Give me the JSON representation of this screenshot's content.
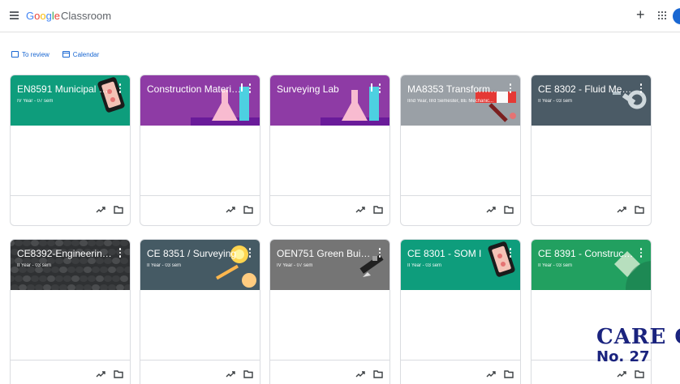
{
  "app": {
    "brand_google": [
      "G",
      "o",
      "o",
      "g",
      "l",
      "e"
    ],
    "brand_product": "Classroom"
  },
  "subnav": {
    "to_review": "To review",
    "calendar": "Calendar"
  },
  "colors": {
    "teal": "#0e9d7c",
    "purple": "#8e3ba5",
    "gray": "#9aa0a6",
    "slate": "#4b5b66",
    "dark": "#2f3133",
    "green": "#22a060",
    "accent": "#1967d2"
  },
  "cards": [
    {
      "title": "EN8591 Municipal soli...",
      "section": "IV Year - 07 sem",
      "color": "#0e9d7c",
      "art": "phone"
    },
    {
      "title": "Construction Materia...",
      "section": "",
      "color": "#8e3ba5",
      "art": "flask"
    },
    {
      "title": "Surveying Lab",
      "section": "",
      "color": "#8e3ba5",
      "art": "flask"
    },
    {
      "title": "MA8353 Transforms ...",
      "section": "IInd Year, IIrd Semester, BE Mechanic...",
      "color": "#9aa0a6",
      "art": "tools"
    },
    {
      "title": "CE 8302 - Fluid Mech...",
      "section": "II Year - 03 sem",
      "color": "#4b5b66",
      "art": "wrench"
    },
    {
      "title": "CE8392-Engineering ...",
      "section": "II Year - 03 sem",
      "color": "#2f3133",
      "art": "gravel"
    },
    {
      "title": "CE 8351 / Surveying",
      "section": "II Year - 03 sem",
      "color": "#455a64",
      "art": "bulb"
    },
    {
      "title": "OEN751 Green Buildi...",
      "section": "IV Year - 07 sem",
      "color": "#757575",
      "art": "pen"
    },
    {
      "title": "CE 8301 - SOM I",
      "section": "II Year - 03 sem",
      "color": "#0e9d7c",
      "art": "phone"
    },
    {
      "title": "CE 8391 - Constructi...",
      "section": "II Year - 03 sem",
      "color": "#22a060",
      "art": "diamond"
    }
  ],
  "watermark": {
    "line1": "CARE C",
    "line2": "No. 27"
  },
  "icons": [
    "menu-icon",
    "plus-icon",
    "apps-icon",
    "review-icon",
    "calendar-icon",
    "more-vert-icon",
    "trending-icon",
    "folder-icon"
  ]
}
